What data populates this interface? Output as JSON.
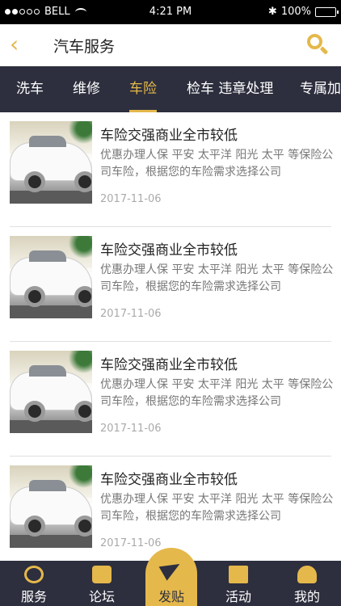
{
  "status": {
    "carrier": "BELL",
    "time": "4:21 PM",
    "battery": "100%"
  },
  "nav": {
    "title": "汽车服务"
  },
  "tabs": [
    {
      "label": "洗车"
    },
    {
      "label": "维修"
    },
    {
      "label": "车险"
    },
    {
      "label": "检车 违章处理"
    },
    {
      "label": "专属加油"
    }
  ],
  "list": [
    {
      "title": "车险交强商业全市较低",
      "desc": "优惠办理人保 平安 太平洋 阳光 太平 等保险公司车险，根据您的车险需求选择公司",
      "date": "2017-11-06"
    },
    {
      "title": "车险交强商业全市较低",
      "desc": "优惠办理人保 平安 太平洋 阳光 太平 等保险公司车险，根据您的车险需求选择公司",
      "date": "2017-11-06"
    },
    {
      "title": "车险交强商业全市较低",
      "desc": "优惠办理人保 平安 太平洋 阳光 太平 等保险公司车险，根据您的车险需求选择公司",
      "date": "2017-11-06"
    },
    {
      "title": "车险交强商业全市较低",
      "desc": "优惠办理人保 平安 太平洋 阳光 太平 等保险公司车险，根据您的车险需求选择公司",
      "date": "2017-11-06"
    }
  ],
  "tabbar": {
    "service": "服务",
    "forum": "论坛",
    "post": "发贴",
    "activity": "活动",
    "mine": "我的"
  }
}
